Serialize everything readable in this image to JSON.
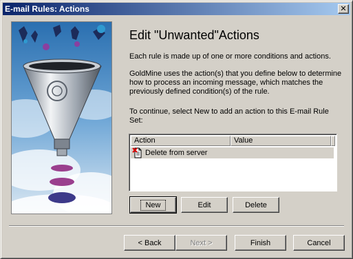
{
  "window": {
    "title": "E-mail Rules: Actions",
    "close_label": "✕"
  },
  "content": {
    "heading": "Edit \"Unwanted\"Actions",
    "paragraph1": "Each rule is made up of one or more conditions and actions.",
    "paragraph2": "GoldMine uses the action(s) that you define below to determine how to process an incoming message, which matches the previously defined condition(s) of the rule.",
    "paragraph3": "To continue, select New to add an action to this E-mail Rule Set:"
  },
  "actions_list": {
    "columns": [
      "Action",
      "Value"
    ],
    "rows": [
      {
        "action": "Delete from server",
        "value": "",
        "icon": "delete-document-icon",
        "selected": true
      }
    ]
  },
  "list_buttons": {
    "new_label": "New",
    "edit_label": "Edit",
    "delete_label": "Delete"
  },
  "wizard_buttons": {
    "back_label": "< Back",
    "next_label": "Next >",
    "finish_label": "Finish",
    "cancel_label": "Cancel"
  },
  "icons": {
    "close": "close-icon",
    "row": "delete-document-icon"
  },
  "colors": {
    "titlebar_start": "#0a246a",
    "titlebar_end": "#a6caf0",
    "dialog_face": "#d4d0c8",
    "selection": "#d4d0c8"
  }
}
